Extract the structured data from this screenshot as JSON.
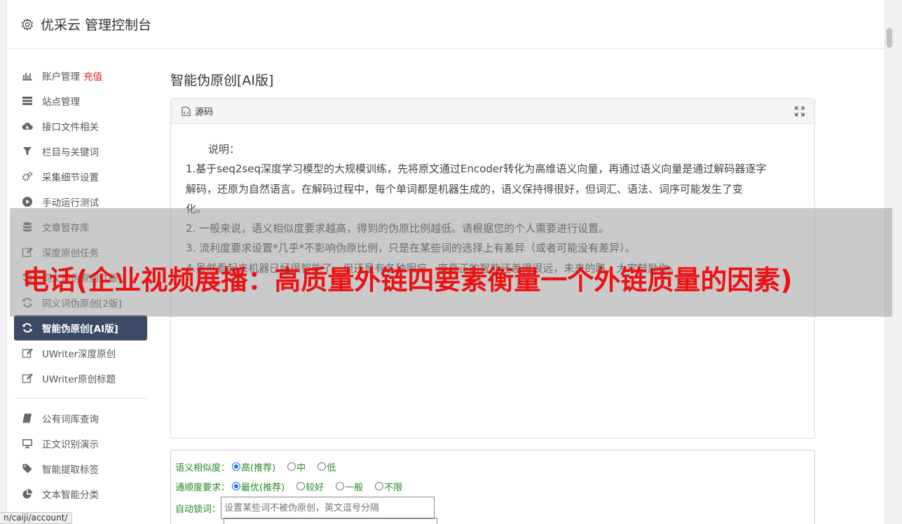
{
  "header": {
    "title": "优采云 管理控制台",
    "icon": "gear-icon"
  },
  "sidebar": {
    "items": [
      {
        "label": "账户管理",
        "extra": "充值",
        "icon": "bar-chart-icon"
      },
      {
        "label": "站点管理",
        "icon": "server-icon"
      },
      {
        "label": "接口文件相关",
        "icon": "cloud-download-icon"
      },
      {
        "label": "栏目与关键词",
        "icon": "filter-icon"
      },
      {
        "label": "采集细节设置",
        "icon": "cogs-icon"
      },
      {
        "label": "手动运行测试",
        "icon": "play-circle-icon"
      },
      {
        "label": "文章暂存库",
        "icon": "database-icon"
      },
      {
        "label": "深度原创任务",
        "icon": "edit-icon"
      },
      {
        "label": "同义词伪原创[1版]",
        "icon": "refresh-icon"
      },
      {
        "label": "同义词伪原创[2版]",
        "icon": "refresh-icon"
      },
      {
        "label": "智能伪原创[AI版]",
        "icon": "refresh-icon",
        "active": true
      },
      {
        "label": "UWriter深度原创",
        "icon": "edit-icon"
      },
      {
        "label": "UWriter原创标题",
        "icon": "edit-icon"
      }
    ],
    "items2": [
      {
        "label": "公有词库查询",
        "icon": "book-icon"
      },
      {
        "label": "正文识别演示",
        "icon": "monitor-icon"
      },
      {
        "label": "智能提取标签",
        "icon": "tag-icon"
      },
      {
        "label": "文本智能分类",
        "icon": "pie-chart-icon"
      }
    ]
  },
  "main": {
    "title": "智能伪原创[AI版]",
    "panel": {
      "head_label": "源码",
      "lines": [
        "说明：",
        "1.基于seq2seq深度学习模型的大规模训练，先将原文通过Encoder转化为高维语义向量，再通过语义向量是通过解码器逐字",
        "解码，还原为自然语言。在解码过程中，每个单词都是机器生成的，语义保持得很好，但词汇、语法、词序可能发生了变",
        "化。",
        "2. 一般来说，语义相似度要求越高，得到的伪原比例越低。请根据您的个人需要进行设置。",
        "3. 流利度要求设置*几乎*不影响伪原比例，只是在某些词的选择上有差异（或者可能没有差异）。",
        "4.虽然看起来机器已经很智能了，但还是有各种瑕疵，离真正的智能还差得很远，未来的路，大家鼓励你。"
      ]
    }
  },
  "overlay": {
    "text": "电话(企业视频展播：高质量外链四要素衡量一个外链质量的因素)"
  },
  "form": {
    "similarity": {
      "label": "语义相似度：",
      "options": [
        "高(推荐)",
        "中",
        "低"
      ],
      "selected": 0
    },
    "fluency": {
      "label": "通顺度要求：",
      "options": [
        "最优(推荐)",
        "较好",
        "一般",
        "不限"
      ],
      "selected": 0
    },
    "lock": {
      "label": "自动锁词：",
      "placeholder": "设置某些词不被伪原创，英文逗号分隔"
    }
  },
  "status_url": "n/caiji/account/"
}
